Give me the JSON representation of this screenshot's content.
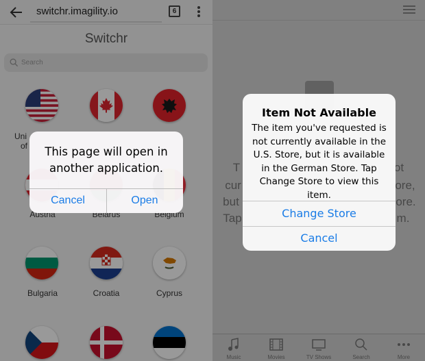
{
  "left": {
    "browser": {
      "url": "switchr.imagility.io",
      "tab_count": "6"
    },
    "app_title": "Switchr",
    "search": {
      "placeholder": "Search"
    },
    "countries": [
      {
        "name": "United States of America",
        "visible_label": "Uni",
        "visible_label_2": "of"
      },
      {
        "name": "Canada"
      },
      {
        "name": "Albania"
      },
      {
        "name": "Austria"
      },
      {
        "name": "Belarus"
      },
      {
        "name": "Belgium"
      },
      {
        "name": "Bulgaria"
      },
      {
        "name": "Croatia"
      },
      {
        "name": "Cyprus"
      },
      {
        "name": "Czech Republic"
      },
      {
        "name": "Denmark"
      },
      {
        "name": "Estonia"
      }
    ],
    "alert": {
      "message": "This page will open in another application.",
      "cancel_label": "Cancel",
      "open_label": "Open"
    }
  },
  "right": {
    "background_lines": [
      "T",
      "cur",
      "but",
      "Tap",
      "ot",
      "ore,",
      "ore.",
      "m."
    ],
    "alert": {
      "title": "Item Not Available",
      "message": "The item you've requested is not currently available in the U.S. Store, but it is available in the German Store. Tap Change Store to view this item.",
      "primary_label": "Change Store",
      "cancel_label": "Cancel"
    },
    "tabbar": [
      {
        "label": "Music",
        "icon": "music-note-icon"
      },
      {
        "label": "Movies",
        "icon": "film-strip-icon"
      },
      {
        "label": "TV Shows",
        "icon": "tv-icon"
      },
      {
        "label": "Search",
        "icon": "magnifier-icon"
      },
      {
        "label": "More",
        "icon": "more-dots-icon"
      }
    ]
  },
  "colors": {
    "ios_blue": "#1a7ce6",
    "dim_overlay": "#000000"
  }
}
